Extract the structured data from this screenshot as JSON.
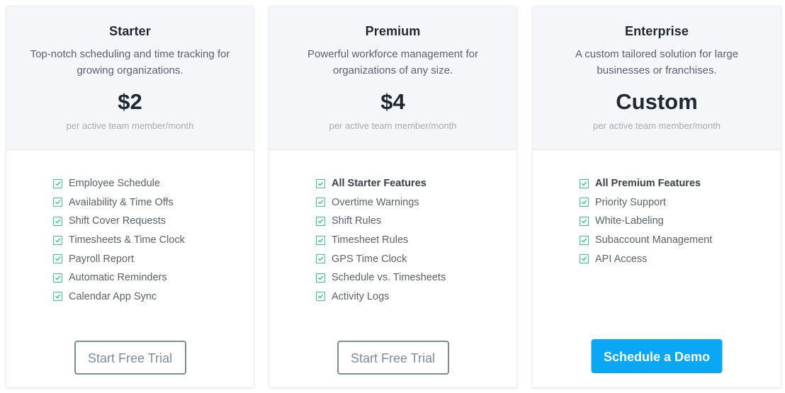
{
  "plans": [
    {
      "name": "Starter",
      "description": "Top-notch scheduling and time tracking for growing organizations.",
      "price": "$2",
      "price_unit": "per active team member/month",
      "features": [
        {
          "label": "Employee Schedule",
          "bold": false
        },
        {
          "label": "Availability & Time Offs",
          "bold": false
        },
        {
          "label": "Shift Cover Requests",
          "bold": false
        },
        {
          "label": "Timesheets & Time Clock",
          "bold": false
        },
        {
          "label": "Payroll Report",
          "bold": false
        },
        {
          "label": "Automatic Reminders",
          "bold": false
        },
        {
          "label": "Calendar App Sync",
          "bold": false
        }
      ],
      "cta": {
        "label": "Start Free Trial",
        "style": "outline"
      }
    },
    {
      "name": "Premium",
      "description": "Powerful workforce management for organizations of any size.",
      "price": "$4",
      "price_unit": "per active team member/month",
      "features": [
        {
          "label": "All Starter Features",
          "bold": true
        },
        {
          "label": "Overtime Warnings",
          "bold": false
        },
        {
          "label": "Shift Rules",
          "bold": false
        },
        {
          "label": "Timesheet Rules",
          "bold": false
        },
        {
          "label": "GPS Time Clock",
          "bold": false
        },
        {
          "label": "Schedule vs. Timesheets",
          "bold": false
        },
        {
          "label": "Activity Logs",
          "bold": false
        }
      ],
      "cta": {
        "label": "Start Free Trial",
        "style": "outline"
      }
    },
    {
      "name": "Enterprise",
      "description": "A custom tailored solution for large businesses or franchises.",
      "price": "Custom",
      "price_unit": "per active team member/month",
      "features": [
        {
          "label": "All Premium Features",
          "bold": true
        },
        {
          "label": "Priority Support",
          "bold": false
        },
        {
          "label": "White-Labeling",
          "bold": false
        },
        {
          "label": "Subaccount Management",
          "bold": false
        },
        {
          "label": "API Access",
          "bold": false
        }
      ],
      "cta": {
        "label": "Schedule a Demo",
        "style": "solid"
      }
    }
  ],
  "icons": {
    "feature_check": "checkbox-checked-icon"
  },
  "colors": {
    "check": "#3fbf96",
    "primary_button": "#0aa7f5",
    "outline_button": "#7b8ca1",
    "header_bg": "#f5f6f9"
  }
}
